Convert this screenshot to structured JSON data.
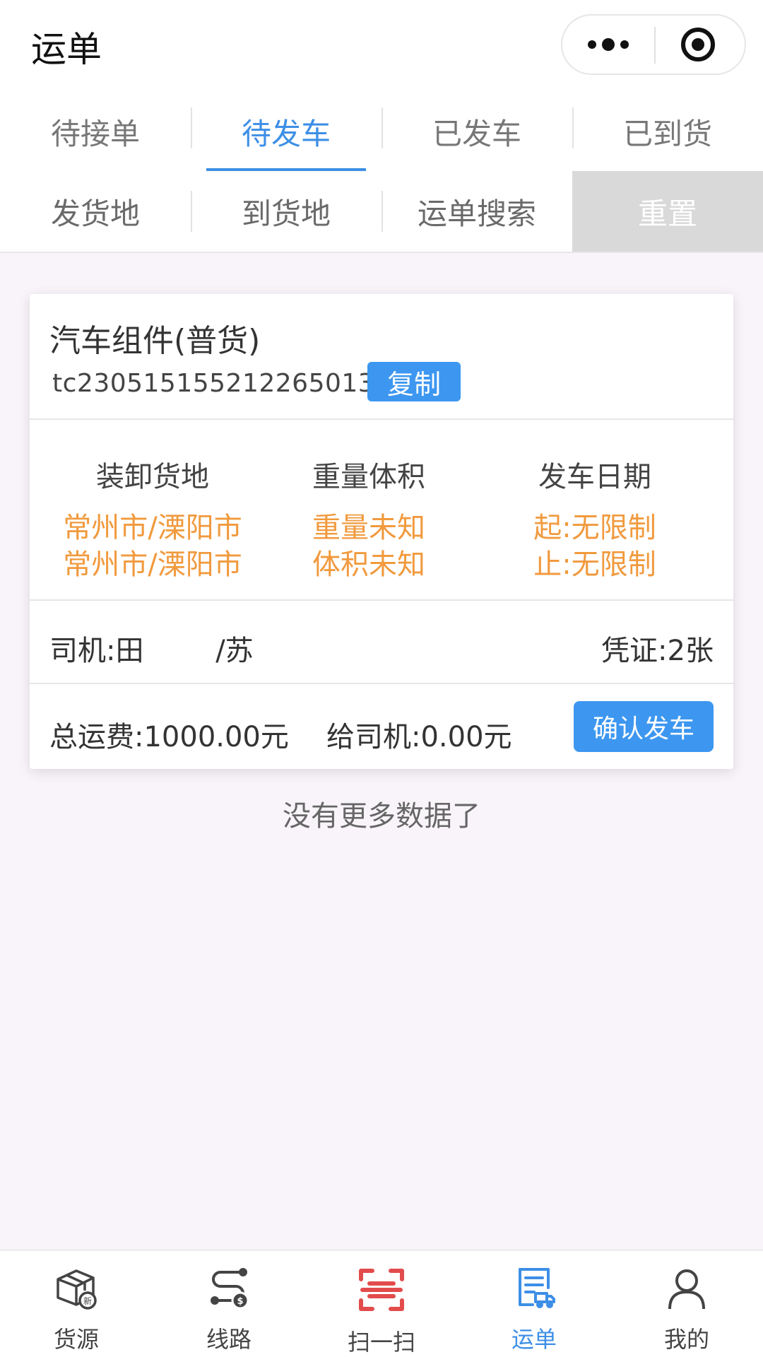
{
  "header": {
    "title": "运单"
  },
  "status_tabs": [
    {
      "label": "待接单",
      "active": false
    },
    {
      "label": "待发车",
      "active": true
    },
    {
      "label": "已发车",
      "active": false
    },
    {
      "label": "已到货",
      "active": false
    }
  ],
  "filters": {
    "origin": "发货地",
    "destination": "到货地",
    "search": "运单搜索",
    "reset": "重置"
  },
  "order": {
    "cargo_name": "汽车组件(普货)",
    "order_no": "tc230515155212265013",
    "copy_label": "复制",
    "columns": [
      {
        "header": "装卸货地",
        "line1": "常州市/溧阳市",
        "line2": "常州市/溧阳市"
      },
      {
        "header": "重量体积",
        "line1": "重量未知",
        "line2": "体积未知"
      },
      {
        "header": "发车日期",
        "line1": "起:无限制",
        "line2": "止:无限制"
      }
    ],
    "driver": "司机:田        /苏",
    "voucher": "凭证:2张",
    "total_freight": "总运费:1000.00元",
    "to_driver": "给司机:0.00元",
    "confirm_label": "确认发车"
  },
  "list_end": "没有更多数据了",
  "tabbar": [
    {
      "label": "货源",
      "icon": "cargo-box-icon",
      "active": false
    },
    {
      "label": "线路",
      "icon": "route-icon",
      "active": false
    },
    {
      "label": "扫一扫",
      "icon": "scan-icon",
      "active": false
    },
    {
      "label": "运单",
      "icon": "waybill-icon",
      "active": true
    },
    {
      "label": "我的",
      "icon": "user-icon",
      "active": false
    }
  ],
  "colors": {
    "accent": "#3d8fe6",
    "button": "#3d97f0",
    "highlight": "#f19a3e",
    "scan": "#e24c4c",
    "reset_bg": "#d9d9d9"
  }
}
